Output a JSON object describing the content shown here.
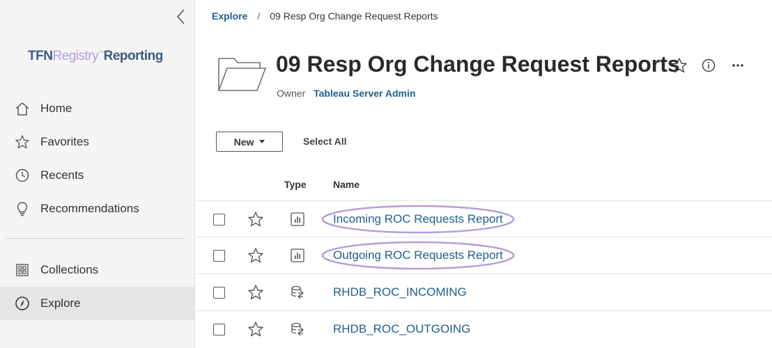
{
  "sidebar": {
    "logo": {
      "part1": "TFN",
      "part2": "Registry",
      "tm": "™",
      "part3": "Reporting"
    },
    "items": [
      {
        "label": "Home",
        "icon": "home-icon"
      },
      {
        "label": "Favorites",
        "icon": "star-icon"
      },
      {
        "label": "Recents",
        "icon": "clock-icon"
      },
      {
        "label": "Recommendations",
        "icon": "lightbulb-icon"
      },
      {
        "label": "Collections",
        "icon": "collections-icon"
      },
      {
        "label": "Explore",
        "icon": "compass-icon",
        "active": true
      }
    ]
  },
  "breadcrumb": {
    "root": "Explore",
    "separator": "/",
    "current": "09 Resp Org Change Request Reports"
  },
  "header": {
    "title": "09 Resp Org Change Request Reports",
    "owner_label": "Owner",
    "owner_name": "Tableau Server Admin"
  },
  "toolbar": {
    "new_label": "New",
    "select_all_label": "Select All"
  },
  "table": {
    "columns": {
      "type": "Type",
      "name": "Name"
    },
    "rows": [
      {
        "type": "workbook",
        "name": "Incoming ROC Requests Report",
        "highlighted": true
      },
      {
        "type": "workbook",
        "name": "Outgoing ROC Requests Report",
        "highlighted": true
      },
      {
        "type": "datasource",
        "name": "RHDB_ROC_INCOMING",
        "highlighted": false
      },
      {
        "type": "datasource",
        "name": "RHDB_ROC_OUTGOING",
        "highlighted": false
      }
    ]
  },
  "colors": {
    "link": "#1f5f8b",
    "highlight": "#b39ddb",
    "sidebar_bg": "#f5f5f5"
  }
}
